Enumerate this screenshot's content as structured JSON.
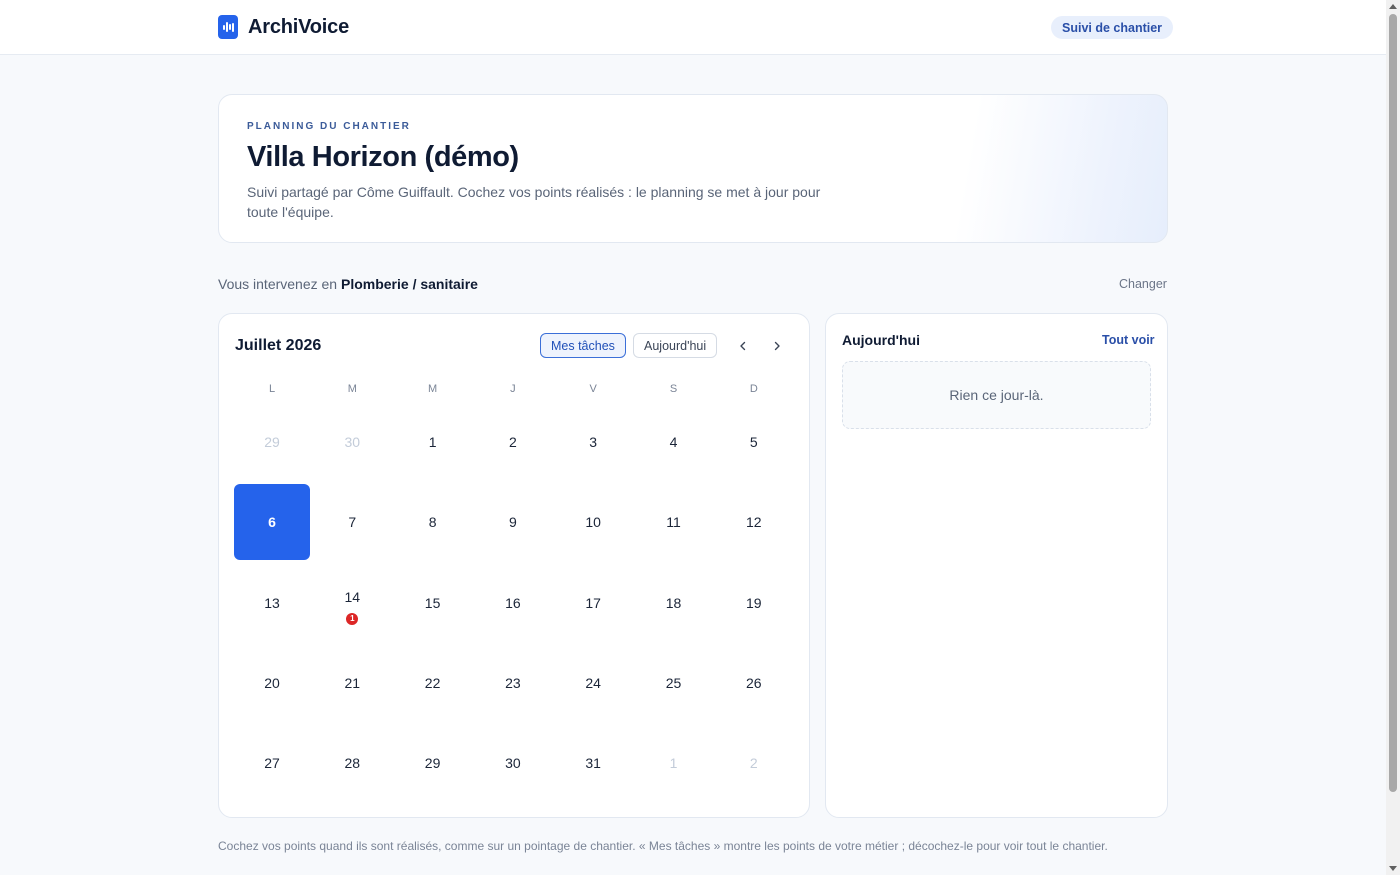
{
  "header": {
    "brand": "ArchiVoice",
    "pill": "Suivi de chantier"
  },
  "hero": {
    "eyebrow": "PLANNING DU CHANTIER",
    "title": "Villa Horizon (démo)",
    "subtitle": "Suivi partagé par Côme Guiffault. Cochez vos points réalisés : le planning se met à jour pour toute l'équipe."
  },
  "trade": {
    "prefix": "Vous intervenez en",
    "name": "Plomberie / sanitaire",
    "change": "Changer"
  },
  "calendar": {
    "month": "Juillet 2026",
    "tasks_button": "Mes tâches",
    "today_button": "Aujourd'hui",
    "weekdays": [
      "L",
      "M",
      "M",
      "J",
      "V",
      "S",
      "D"
    ],
    "weeks": [
      [
        {
          "d": "29",
          "m": true
        },
        {
          "d": "30",
          "m": true
        },
        {
          "d": "1"
        },
        {
          "d": "2"
        },
        {
          "d": "3"
        },
        {
          "d": "4"
        },
        {
          "d": "5"
        }
      ],
      [
        {
          "d": "6",
          "sel": true
        },
        {
          "d": "7"
        },
        {
          "d": "8"
        },
        {
          "d": "9"
        },
        {
          "d": "10"
        },
        {
          "d": "11"
        },
        {
          "d": "12"
        }
      ],
      [
        {
          "d": "13"
        },
        {
          "d": "14",
          "badge": "1"
        },
        {
          "d": "15"
        },
        {
          "d": "16"
        },
        {
          "d": "17"
        },
        {
          "d": "18"
        },
        {
          "d": "19"
        }
      ],
      [
        {
          "d": "20"
        },
        {
          "d": "21"
        },
        {
          "d": "22"
        },
        {
          "d": "23"
        },
        {
          "d": "24"
        },
        {
          "d": "25"
        },
        {
          "d": "26"
        }
      ],
      [
        {
          "d": "27"
        },
        {
          "d": "28"
        },
        {
          "d": "29"
        },
        {
          "d": "30"
        },
        {
          "d": "31"
        },
        {
          "d": "1",
          "m": true
        },
        {
          "d": "2",
          "m": true
        }
      ]
    ]
  },
  "today_panel": {
    "title": "Aujourd'hui",
    "see_all": "Tout voir",
    "empty": "Rien ce jour-là."
  },
  "footnote": "Cochez vos points quand ils sont réalisés, comme sur un pointage de chantier. « Mes tâches » montre les points de votre métier ; décochez-le pour voir tout le chantier.",
  "colors": {
    "accent": "#2563eb",
    "badge": "#dc2626"
  }
}
